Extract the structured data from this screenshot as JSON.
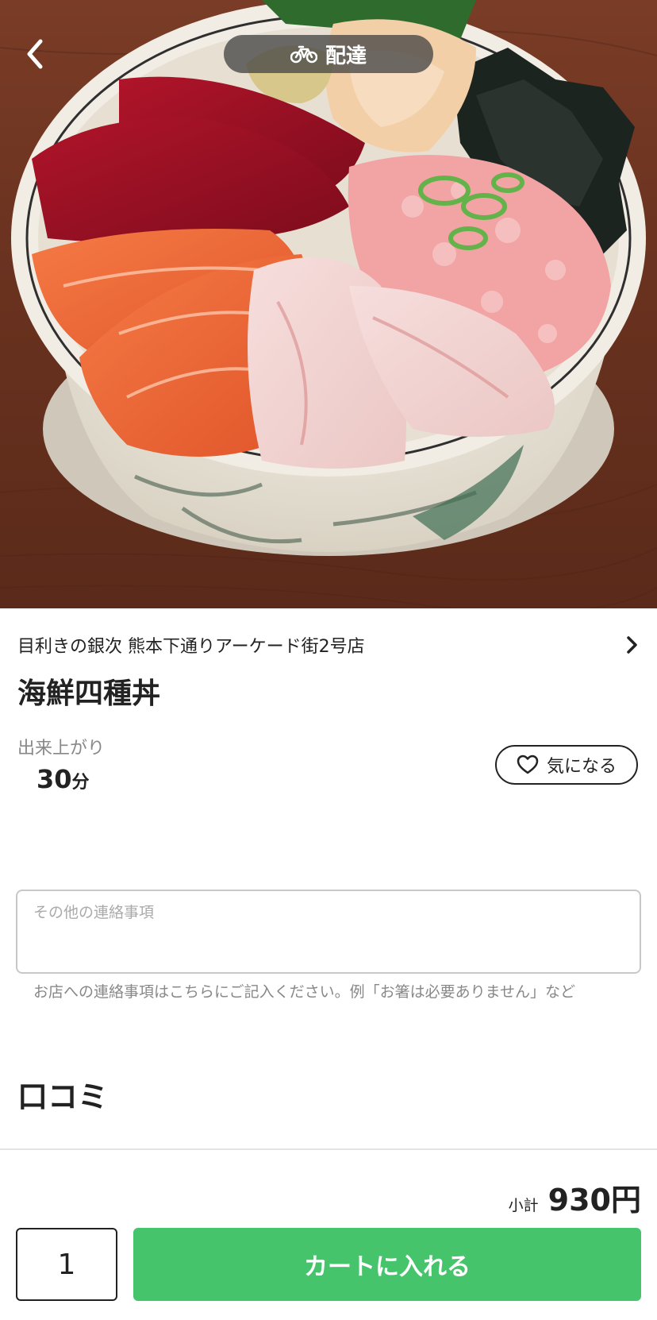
{
  "header": {
    "mode_label": "配達",
    "back_icon": "chevron-left-icon",
    "mode_icon": "bicycle-icon"
  },
  "hero": {
    "image": "kaisen-donburi-photo"
  },
  "item": {
    "shop_name": "目利きの銀次 熊本下通りアーケード街2号店",
    "title": "海鮮四種丼",
    "lead_time_label": "出来上がり",
    "lead_time_value": "30",
    "lead_time_unit": "分",
    "favorite_label": "気になる"
  },
  "note": {
    "placeholder": "その他の連絡事項",
    "value": "",
    "help_text": "お店への連絡事項はこちらにご記入ください。例「お箸は必要ありません」など"
  },
  "reviews": {
    "title": "口コミ"
  },
  "footer": {
    "subtotal_label": "小計",
    "subtotal_value": "930円",
    "quantity": "1",
    "cart_button_label": "カートに入れる"
  },
  "colors": {
    "accent_green": "#45c46b",
    "text_primary": "#222222",
    "text_secondary": "#888888",
    "pill_background": "#464646"
  }
}
